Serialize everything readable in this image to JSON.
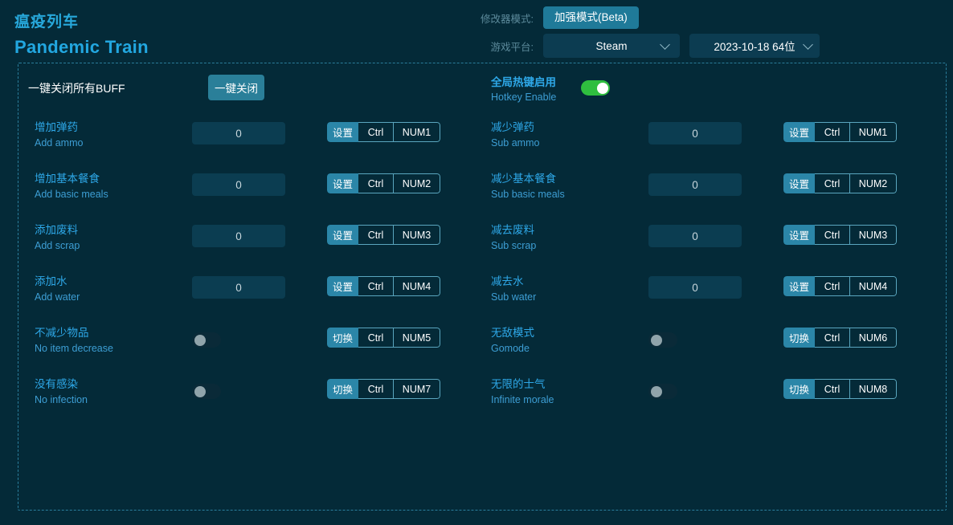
{
  "app": {
    "title_zh": "瘟疫列车",
    "title_en": "Pandemic Train"
  },
  "header": {
    "mode_label": "修改器模式:",
    "mode_value": "加强模式(Beta)",
    "platform_label": "游戏平台:",
    "platform_value": "Steam",
    "version_value": "2023-10-18 64位",
    "chevron_icon": "chevron-down-icon"
  },
  "panel": {
    "buff_label": "一键关闭所有BUFF",
    "buff_button": "一键关闭",
    "hotkey_zh": "全局热键启用",
    "hotkey_en": "Hotkey Enable",
    "hotkey_enabled": true
  },
  "left_rows": [
    {
      "zh": "增加弹药",
      "en": "Add ammo",
      "control": "input",
      "value": "0",
      "action": "设置",
      "mod": "Ctrl",
      "key": "NUM1"
    },
    {
      "zh": "增加基本餐食",
      "en": "Add basic meals",
      "control": "input",
      "value": "0",
      "action": "设置",
      "mod": "Ctrl",
      "key": "NUM2"
    },
    {
      "zh": "添加废料",
      "en": "Add scrap",
      "control": "input",
      "value": "0",
      "action": "设置",
      "mod": "Ctrl",
      "key": "NUM3"
    },
    {
      "zh": "添加水",
      "en": "Add water",
      "control": "input",
      "value": "0",
      "action": "设置",
      "mod": "Ctrl",
      "key": "NUM4"
    },
    {
      "zh": "不减少物品",
      "en": "No item decrease",
      "control": "switch",
      "enabled": false,
      "action": "切换",
      "mod": "Ctrl",
      "key": "NUM5"
    },
    {
      "zh": "没有感染",
      "en": "No infection",
      "control": "switch",
      "enabled": false,
      "action": "切换",
      "mod": "Ctrl",
      "key": "NUM7"
    }
  ],
  "right_rows": [
    {
      "zh": "减少弹药",
      "en": "Sub ammo",
      "control": "input",
      "value": "0",
      "action": "设置",
      "mod": "Ctrl",
      "key": "NUM1"
    },
    {
      "zh": "减少基本餐食",
      "en": "Sub basic meals",
      "control": "input",
      "value": "0",
      "action": "设置",
      "mod": "Ctrl",
      "key": "NUM2"
    },
    {
      "zh": "减去废料",
      "en": "Sub scrap",
      "control": "input",
      "value": "0",
      "action": "设置",
      "mod": "Ctrl",
      "key": "NUM3"
    },
    {
      "zh": "减去水",
      "en": "Sub water",
      "control": "input",
      "value": "0",
      "action": "设置",
      "mod": "Ctrl",
      "key": "NUM4"
    },
    {
      "zh": "无敌模式",
      "en": "Gomode",
      "control": "switch",
      "enabled": false,
      "action": "切换",
      "mod": "Ctrl",
      "key": "NUM6"
    },
    {
      "zh": "无限的士气",
      "en": "Infinite morale",
      "control": "switch",
      "enabled": false,
      "action": "切换",
      "mod": "Ctrl",
      "key": "NUM8"
    }
  ],
  "colors": {
    "background": "#042a38",
    "panel_border": "#2a7d9b",
    "accent_teal": "#2a7f99",
    "label_blue": "#2ea8e8",
    "sub_label_blue": "#3d9ed4",
    "toggle_on_green": "#2fbe3f",
    "input_bg": "#0b3d51"
  }
}
